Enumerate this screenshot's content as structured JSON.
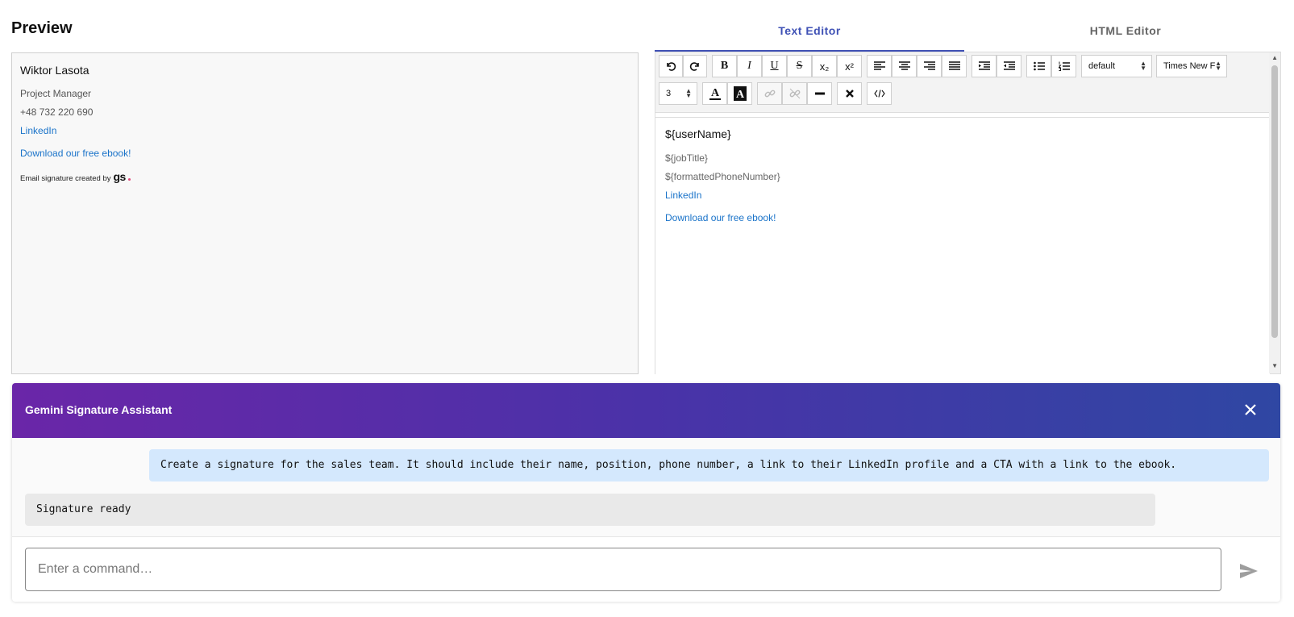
{
  "preview": {
    "title": "Preview",
    "signature": {
      "name": "Wiktor Lasota",
      "job_title": "Project Manager",
      "phone": "+48 732 220 690",
      "linkedin": "LinkedIn",
      "cta": "Download our free ebook!",
      "credit": "Email signature created by",
      "credit_logo": "gs"
    }
  },
  "tabs": [
    {
      "label": "Text Editor",
      "active": true
    },
    {
      "label": "HTML Editor",
      "active": false
    }
  ],
  "toolbar": {
    "font_size_select": "default",
    "font_family_select": "Times New F",
    "line_height_select": "3"
  },
  "editor": {
    "name": "${userName}",
    "job_title": "${jobTitle}",
    "phone": "${formattedPhoneNumber}",
    "linkedin": "LinkedIn",
    "cta": "Download our free ebook!"
  },
  "assistant": {
    "title": "Gemini Signature Assistant",
    "messages": [
      {
        "role": "user",
        "text": "Create a signature for the sales team. It should include their name, position, phone number, a link to their LinkedIn profile and a CTA with a link to the ebook."
      },
      {
        "role": "assistant",
        "text": "Signature ready"
      }
    ],
    "input_placeholder": "Enter a command…"
  },
  "colors": {
    "accent": "#3f51b5",
    "link": "#1a73c9",
    "header_gradient_start": "#6a26a8",
    "header_gradient_end": "#2f47a3",
    "user_bubble": "#d4e8fd",
    "bot_bubble": "#e9e9e9"
  }
}
